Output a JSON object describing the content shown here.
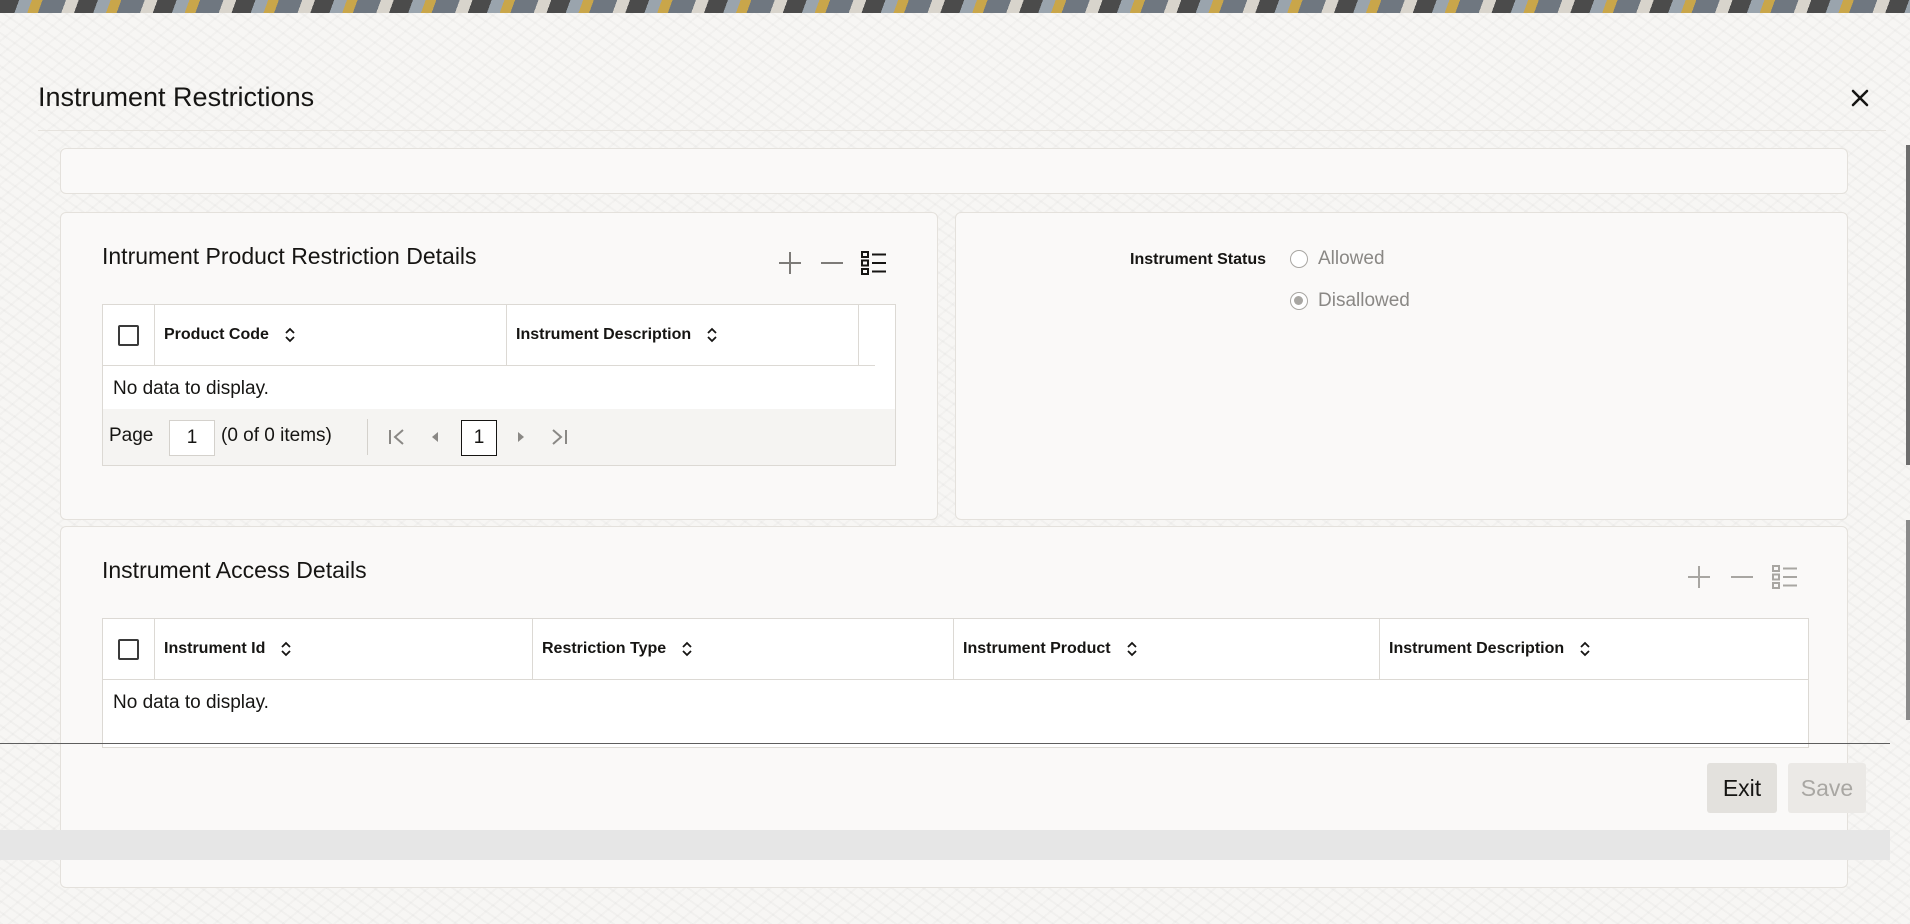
{
  "dialog": {
    "title": "Instrument Restrictions"
  },
  "product_restriction": {
    "title": "Intrument Product Restriction Details",
    "columns": [
      "Product Code",
      "Instrument Description"
    ],
    "empty_text": "No data to display.",
    "pager": {
      "label": "Page",
      "page_input": "1",
      "items_text": "(0 of 0 items)",
      "current_page": "1"
    }
  },
  "status": {
    "label": "Instrument Status",
    "options": [
      "Allowed",
      "Disallowed"
    ],
    "selected": "Disallowed"
  },
  "access_details": {
    "title": "Instrument Access Details",
    "columns": [
      "Instrument Id",
      "Restriction Type",
      "Instrument Product",
      "Instrument Description"
    ],
    "empty_text": "No data to display."
  },
  "footer": {
    "exit_label": "Exit",
    "save_label": "Save"
  },
  "icons": {
    "close": "close-icon",
    "add": "plus-icon",
    "remove": "minus-icon",
    "columns": "list-columns-icon",
    "sort": "sort-updown-icon",
    "first": "first-page-icon",
    "prev": "prev-page-icon",
    "next": "next-page-icon",
    "last": "last-page-icon"
  },
  "colors": {
    "text": "#161513",
    "disabled_text": "#a9a7a3",
    "border": "#dcd9d4",
    "panel_bg": "#faf9f8"
  }
}
